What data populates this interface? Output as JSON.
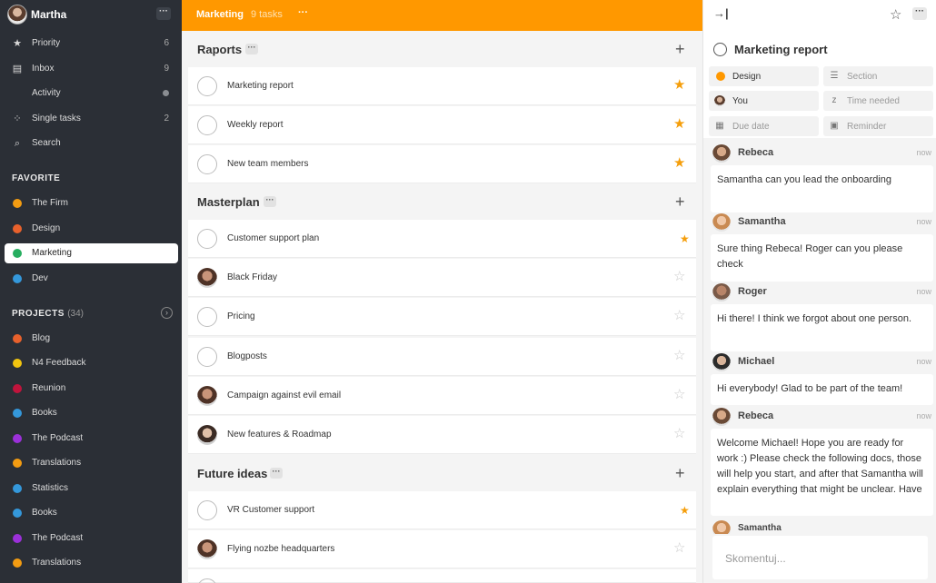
{
  "sidebar": {
    "user_name": "Martha",
    "more": "···",
    "nav": [
      {
        "label": "Priority",
        "icon": "star-icon",
        "glyph": "★",
        "count": "6"
      },
      {
        "label": "Inbox",
        "icon": "inbox-icon",
        "glyph": "▤",
        "count": "9"
      },
      {
        "label": "Activity",
        "icon": "",
        "glyph": "",
        "count": ""
      },
      {
        "label": "Single tasks",
        "icon": "single-tasks-icon",
        "glyph": "⁘",
        "count": "2"
      },
      {
        "label": "Search",
        "icon": "search-icon",
        "glyph": "⌕",
        "count": ""
      }
    ],
    "favorite_heading": "FAVORITE",
    "favorites": [
      {
        "label": "The Firm",
        "color": "#f39c12"
      },
      {
        "label": "Design",
        "color": "#e8612c"
      },
      {
        "label": "Marketing",
        "color": "#27ae60"
      },
      {
        "label": "Dev",
        "color": "#3498db"
      }
    ],
    "projects_heading": "PROJECTS",
    "projects_count": "(34)",
    "projects": [
      {
        "label": "Blog",
        "color": "#e8612c"
      },
      {
        "label": "N4 Feedback",
        "color": "#f1c40f"
      },
      {
        "label": "Reunion",
        "color": "#c0143c"
      },
      {
        "label": "Books",
        "color": "#3498db"
      },
      {
        "label": "The Podcast",
        "color": "#9b30d9"
      },
      {
        "label": "Translations",
        "color": "#f39c12"
      },
      {
        "label": "Statistics",
        "color": "#3498db"
      },
      {
        "label": "Books",
        "color": "#3498db"
      },
      {
        "label": "The Podcast",
        "color": "#9b30d9"
      },
      {
        "label": "Translations",
        "color": "#f39c12"
      }
    ]
  },
  "main": {
    "title": "Marketing",
    "count": "9 tasks",
    "more": "···",
    "sections": [
      {
        "title": "Raports",
        "tasks": [
          {
            "name": "Marketing report",
            "star": "on"
          },
          {
            "name": "Weekly report",
            "star": "on"
          },
          {
            "name": "New team members",
            "star": "on"
          }
        ]
      },
      {
        "title": "Masterplan",
        "tasks": [
          {
            "name": "Customer support plan",
            "star": "on"
          },
          {
            "name": "Black Friday",
            "star": "off"
          },
          {
            "name": "Pricing",
            "star": "off"
          },
          {
            "name": "Blogposts",
            "star": "off"
          },
          {
            "name": "Campaign against evil email",
            "star": "off"
          },
          {
            "name": "New features & Roadmap",
            "star": "off"
          }
        ]
      },
      {
        "title": "Future ideas",
        "tasks": [
          {
            "name": "VR Customer support",
            "star": "on"
          },
          {
            "name": "Flying nozbe headquarters",
            "star": "off"
          }
        ]
      }
    ]
  },
  "detail": {
    "title": "Marketing report",
    "more": "···",
    "fields": {
      "project": "Design",
      "section": "Section",
      "assignee": "You",
      "time_needed": "Time needed",
      "due_date": "Due date",
      "reminder": "Reminder"
    },
    "comments": [
      {
        "author": "Rebeca",
        "time": "now",
        "text": "Samantha can you lead the onboarding"
      },
      {
        "author": "Samantha",
        "time": "now",
        "text": "Sure thing Rebeca! Roger can you please check"
      },
      {
        "author": "Roger",
        "time": "now",
        "text": "Hi there! I think we forgot about one person."
      },
      {
        "author": "Michael",
        "time": "now",
        "text": "Hi everybody! Glad to be part of the team!"
      },
      {
        "author": "Rebeca",
        "time": "now",
        "text": "Welcome Michael! Hope you are ready for work :) Please check the following docs, those will help you start, and after that Samantha will explain everything that might be unclear. Have"
      },
      {
        "author": "Samantha",
        "time": "",
        "text": ""
      }
    ],
    "composer_placeholder": "Skomentuj..."
  }
}
